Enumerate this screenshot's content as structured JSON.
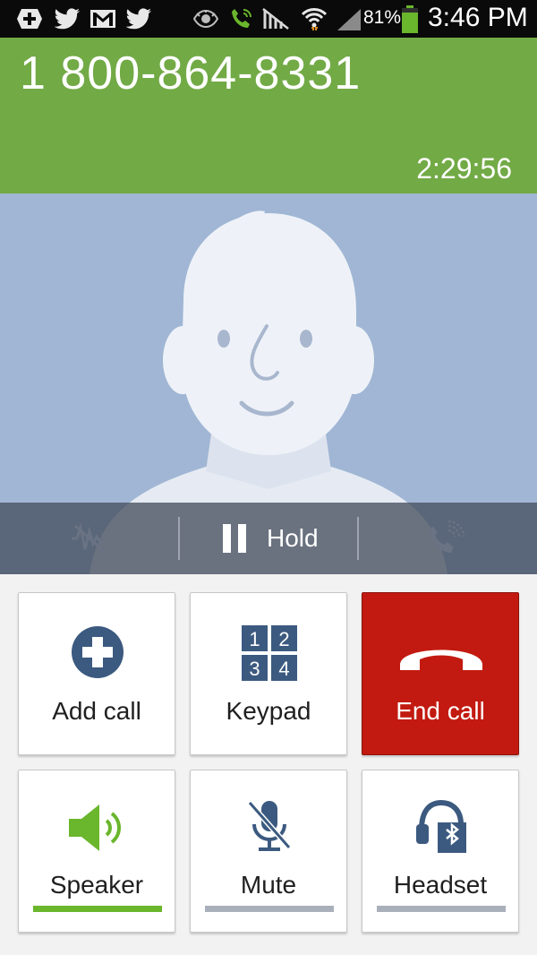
{
  "status_bar": {
    "battery_percent": "81%",
    "time": "3:46 PM",
    "icons": [
      "add-notification-icon",
      "twitter-icon",
      "gmail-icon",
      "twitter-icon",
      "eye-icon",
      "call-active-icon",
      "no-signal-icon",
      "wifi-icon",
      "cell-signal-icon",
      "battery-icon"
    ]
  },
  "call": {
    "number": "1 800-864-8331",
    "duration": "2:29:56"
  },
  "controls": {
    "hold_label": "Hold",
    "icons": [
      "noise-reduction-icon",
      "pause-icon",
      "extra-volume-icon"
    ]
  },
  "actions": {
    "add_call": "Add call",
    "keypad": "Keypad",
    "end_call": "End call",
    "speaker": "Speaker",
    "mute": "Mute",
    "headset": "Headset",
    "keypad_digits": [
      "1",
      "2",
      "3",
      "4"
    ]
  },
  "colors": {
    "header_green": "#72aa46",
    "end_call_red": "#c21a10",
    "avatar_bg": "#a0b6d4",
    "speaker_active": "#6ab62c",
    "inactive_bar": "#a9b0bb"
  },
  "state": {
    "speaker_on": true,
    "mute_on": false,
    "headset_on": false
  }
}
